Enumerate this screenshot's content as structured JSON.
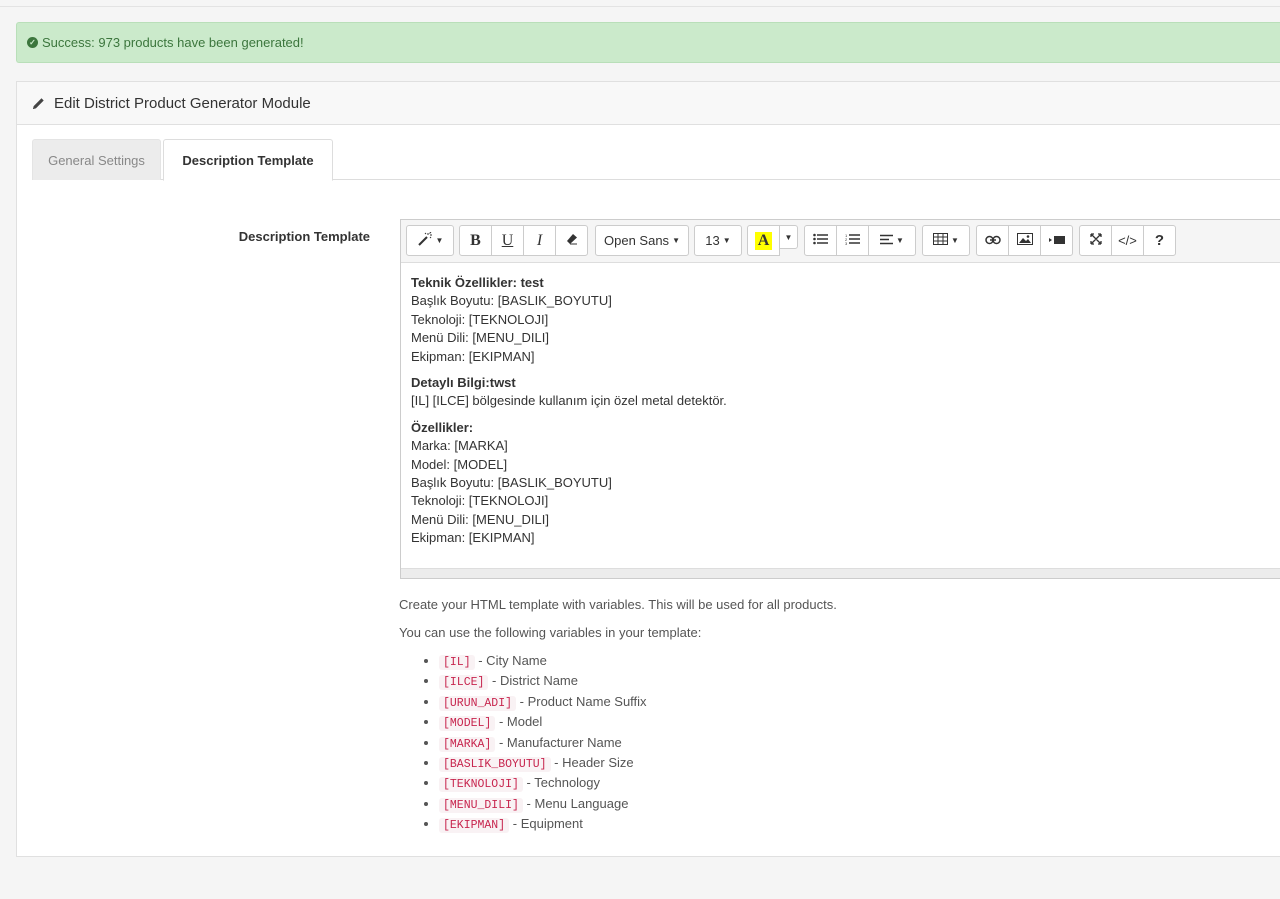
{
  "alert": {
    "message": "Success: 973 products have been generated!"
  },
  "panel": {
    "title": "Edit District Product Generator Module"
  },
  "tabs": [
    {
      "label": "General Settings",
      "active": false
    },
    {
      "label": "Description Template",
      "active": true
    }
  ],
  "field": {
    "label": "Description Template"
  },
  "toolbar": {
    "font_name": "Open Sans",
    "font_size": "13",
    "code_view": "</>",
    "help": "?"
  },
  "editor": {
    "p1_title": "Teknik Özellikler: test",
    "p1_lines": [
      "Başlık Boyutu: [BASLIK_BOYUTU]",
      "Teknoloji: [TEKNOLOJI]",
      "Menü Dili: [MENU_DILI]",
      "Ekipman: [EKIPMAN]"
    ],
    "p2_title": "Detaylı Bilgi:twst",
    "p2_lines": [
      "[IL] [ILCE] bölgesinde kullanım için özel metal detektör."
    ],
    "p3_title": "Özellikler:",
    "p3_lines": [
      "Marka: [MARKA]",
      "Model: [MODEL]",
      "Başlık Boyutu: [BASLIK_BOYUTU]",
      "Teknoloji: [TEKNOLOJI]",
      "Menü Dili: [MENU_DILI]",
      "Ekipman: [EKIPMAN]"
    ]
  },
  "help": {
    "line1": "Create your HTML template with variables. This will be used for all products.",
    "line2": "You can use the following variables in your template:",
    "variables": [
      {
        "code": "[IL]",
        "desc": "- City Name"
      },
      {
        "code": "[ILCE]",
        "desc": "- District Name"
      },
      {
        "code": "[URUN_ADI]",
        "desc": "- Product Name Suffix"
      },
      {
        "code": "[MODEL]",
        "desc": "- Model"
      },
      {
        "code": "[MARKA]",
        "desc": "- Manufacturer Name"
      },
      {
        "code": "[BASLIK_BOYUTU]",
        "desc": "- Header Size"
      },
      {
        "code": "[TEKNOLOJI]",
        "desc": "- Technology"
      },
      {
        "code": "[MENU_DILI]",
        "desc": "- Menu Language"
      },
      {
        "code": "[EKIPMAN]",
        "desc": "- Equipment"
      }
    ]
  },
  "colors": {
    "success_bg": "#cbeacb",
    "success_text": "#3c763d",
    "code_text": "#c7254e",
    "highlight": "#ffff00"
  }
}
